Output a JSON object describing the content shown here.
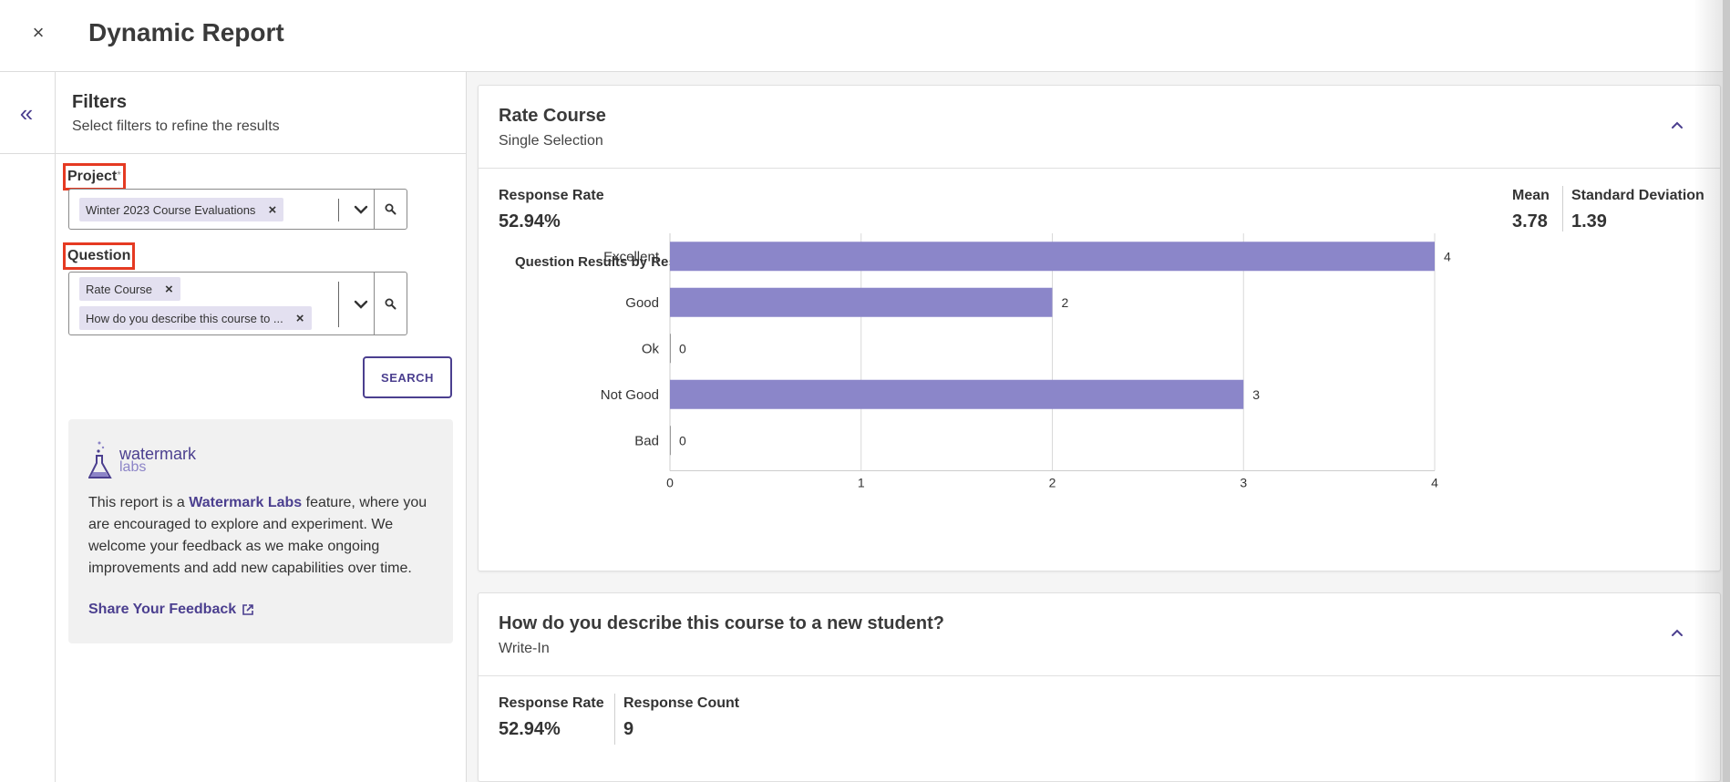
{
  "header": {
    "close_symbol": "×",
    "title": "Dynamic Report"
  },
  "sidebar": {
    "collapse_icon": "chevrons-left-icon",
    "collapse_symbol": "«"
  },
  "filters": {
    "title": "Filters",
    "subtitle": "Select filters to refine the results",
    "project": {
      "label": "Project",
      "required_mark": "*",
      "chips": [
        "Winter 2023 Course Evaluations"
      ]
    },
    "question": {
      "label": "Question",
      "chips": [
        "Rate Course",
        "How do you describe this course to ..."
      ]
    },
    "search_button": "SEARCH"
  },
  "labs": {
    "logo_word": "watermark",
    "logo_sub": "labs",
    "text_before": "This report is a ",
    "text_bold": "Watermark Labs",
    "text_after": " feature, where you are encouraged to explore and experiment. We welcome your feedback as we make ongoing improvements and add new capabilities over time.",
    "feedback_link": "Share Your Feedback"
  },
  "cards": [
    {
      "title": "Rate Course",
      "type": "Single Selection",
      "stats": {
        "response_rate_label": "Response Rate",
        "response_rate": "52.94%",
        "mean_label": "Mean",
        "mean": "3.78",
        "std_label": "Standard Deviation",
        "std": "1.39"
      },
      "chart_title": "Question Results by Response"
    },
    {
      "title": "How do you describe this course to a new student?",
      "type": "Write-In",
      "stats": {
        "response_rate_label": "Response Rate",
        "response_rate": "52.94%",
        "response_count_label": "Response Count",
        "response_count": "9"
      }
    }
  ],
  "chart_data": {
    "type": "bar",
    "orientation": "horizontal",
    "title": "Question Results by Response",
    "categories": [
      "Excellent",
      "Good",
      "Ok",
      "Not Good",
      "Bad"
    ],
    "values": [
      4,
      2,
      0,
      3,
      0
    ],
    "xlim": [
      0,
      4
    ],
    "xticks": [
      0,
      1,
      2,
      3,
      4
    ],
    "bar_color": "#8b86c9",
    "grid": true,
    "data_labels": true
  },
  "colors": {
    "accent": "#4b3f8f",
    "bar": "#8b86c9",
    "chip_bg": "#e3e0f0",
    "highlight": "#e53a22"
  }
}
